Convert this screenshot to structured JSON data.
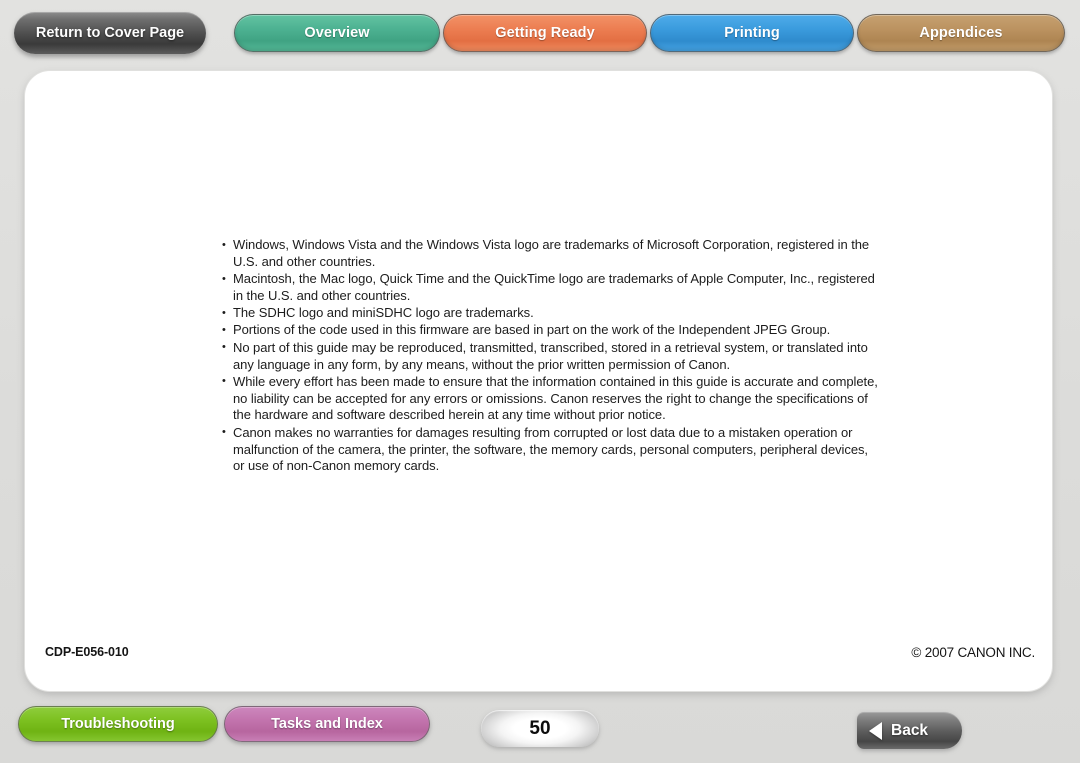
{
  "top_nav": {
    "cover_button": "Return to Cover Page",
    "tabs": [
      {
        "label": "Overview",
        "color": "#4cb191"
      },
      {
        "label": "Getting Ready",
        "color": "#ec7d51"
      },
      {
        "label": "Printing",
        "color": "#3a9bdd"
      },
      {
        "label": "Appendices",
        "color": "#bb9260"
      }
    ]
  },
  "content": {
    "notices": [
      "Windows, Windows Vista and the Windows Vista logo are trademarks of Microsoft Corporation, registered in the U.S. and other countries.",
      "Macintosh, the Mac logo, Quick Time and the QuickTime logo are trademarks of Apple Computer, Inc., registered in the U.S. and other countries.",
      "The SDHC logo and miniSDHC logo are trademarks.",
      "Portions of the code used in this firmware are based in part on the work of the Independent JPEG Group.",
      "No part of this guide may be reproduced, transmitted, transcribed, stored in a retrieval system, or translated into any language in any form, by any means, without the prior written permission of Canon.",
      "While every effort has been made to ensure that the information contained in this guide is accurate and complete, no liability can be accepted for any errors or omissions. Canon reserves the right to change the specifications of the hardware and software described herein at any time without prior notice.",
      "Canon makes no warranties for damages resulting from corrupted or lost data due to a mistaken operation or malfunction of the camera, the printer, the software, the memory cards, personal computers, peripheral devices, or use of non-Canon memory cards."
    ],
    "doc_code": "CDP-E056-010",
    "copyright": "© 2007 CANON INC."
  },
  "bottom_nav": {
    "troubleshooting": {
      "label": "Troubleshooting",
      "color": "#7cc020"
    },
    "tasks_and_index": {
      "label": "Tasks and Index",
      "color": "#c273ad"
    },
    "page_number": "50",
    "back_button": "Back"
  }
}
